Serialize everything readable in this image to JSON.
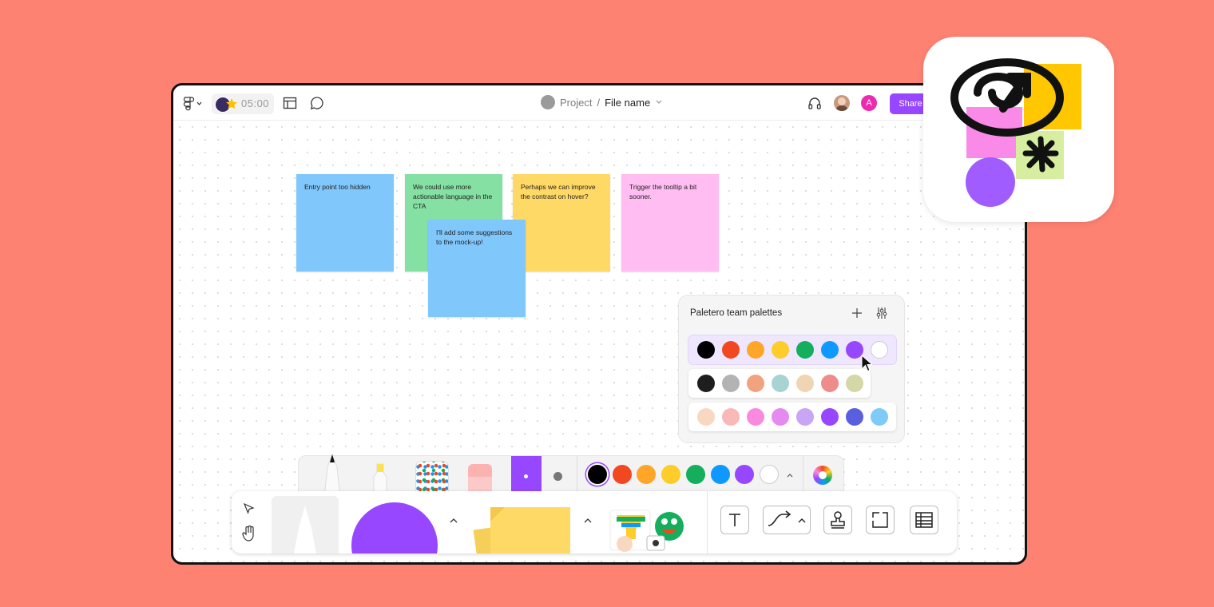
{
  "topbar": {
    "timer_value": "05:00",
    "breadcrumb_project": "Project",
    "breadcrumb_separator": "/",
    "breadcrumb_file": "File name",
    "user_avatar_letter": "A",
    "share_label": "Share"
  },
  "stickies": [
    {
      "text": "Entry point too hidden",
      "color": "#80C7FC"
    },
    {
      "text": "We could use more actionable language in the CTA",
      "color": "#85E0A3"
    },
    {
      "text": "Perhaps we can improve the contrast on hover?",
      "color": "#FFD966"
    },
    {
      "text": "Trigger the tooltip a bit sooner.",
      "color": "#FFBDF2"
    },
    {
      "text": "I'll add some suggestions to the mock-up!",
      "color": "#80C7FC"
    }
  ],
  "palette_panel": {
    "title": "Paletero team palettes",
    "palettes": [
      [
        "#000000",
        "#F24822",
        "#FFA629",
        "#FFCD29",
        "#14AE5C",
        "#0D99FF",
        "#9747FF",
        "#FFFFFF"
      ],
      [
        "#1E1E1E",
        "#B3B3B3",
        "#F3A27F",
        "#A8D3D2",
        "#EFD5B4",
        "#EE8C8C",
        "#D2D8A8"
      ],
      [
        "#F9D8C2",
        "#F9B9B9",
        "#F98ADE",
        "#E58BEF",
        "#C8A6F5",
        "#9747FF",
        "#5A5FE0",
        "#7FCBF8"
      ]
    ]
  },
  "draw_colors": [
    "#000000",
    "#F24822",
    "#FFA629",
    "#FFCD29",
    "#14AE5C",
    "#0D99FF",
    "#9747FF",
    "#FFFFFF"
  ],
  "accent": "#9747FF",
  "background": "#FE8272"
}
